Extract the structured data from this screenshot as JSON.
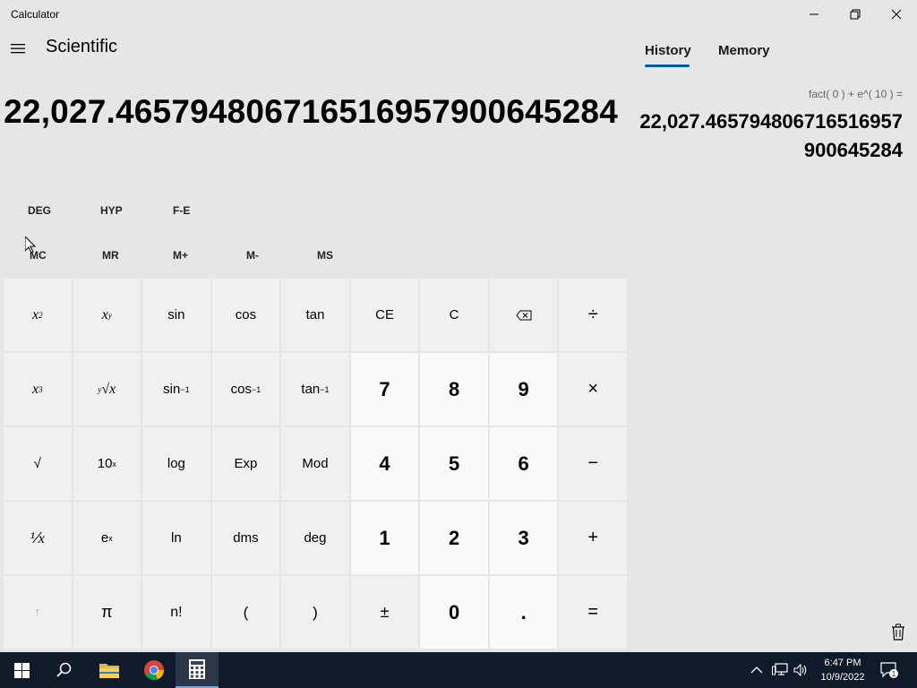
{
  "window": {
    "title": "Calculator"
  },
  "header": {
    "mode": "Scientific"
  },
  "tabs": {
    "history": "History",
    "memory": "Memory"
  },
  "display": {
    "value": "22,027.465794806716516957900645284"
  },
  "history": {
    "expression": "fact( 0 )   +   e^( 10 ) =",
    "result": "22,027.465794806716516957900645284"
  },
  "mode_buttons": {
    "deg": "DEG",
    "hyp": "HYP",
    "fe": "F-E"
  },
  "memory_buttons": {
    "mc": "MC",
    "mr": "MR",
    "mplus": "M+",
    "mminus": "M-",
    "ms": "MS"
  },
  "keys": {
    "sin": "sin",
    "cos": "cos",
    "tan": "tan",
    "ce": "CE",
    "c": "C",
    "asin": "sin",
    "acos": "cos",
    "atan": "tan",
    "inv_sup": "−1",
    "seven": "7",
    "eight": "8",
    "nine": "9",
    "sqrt": "√",
    "log": "log",
    "exp": "Exp",
    "mod": "Mod",
    "four": "4",
    "five": "5",
    "six": "6",
    "ln": "ln",
    "dms": "dms",
    "deg": "deg",
    "one": "1",
    "two": "2",
    "three": "3",
    "pi": "π",
    "fact": "n!",
    "lparen": "(",
    "rparen": ")",
    "plusminus": "±",
    "zero": "0",
    "dot": ".",
    "divide": "÷",
    "multiply": "×",
    "minus": "−",
    "plus": "+",
    "equals": "=",
    "shift": "↑"
  },
  "taskbar": {
    "time": "6:47 PM",
    "date": "10/9/2022",
    "notifications": "1"
  },
  "colors": {
    "accent": "#005a9e",
    "background": "#e6e6e6",
    "taskbar": "#101a2b"
  }
}
